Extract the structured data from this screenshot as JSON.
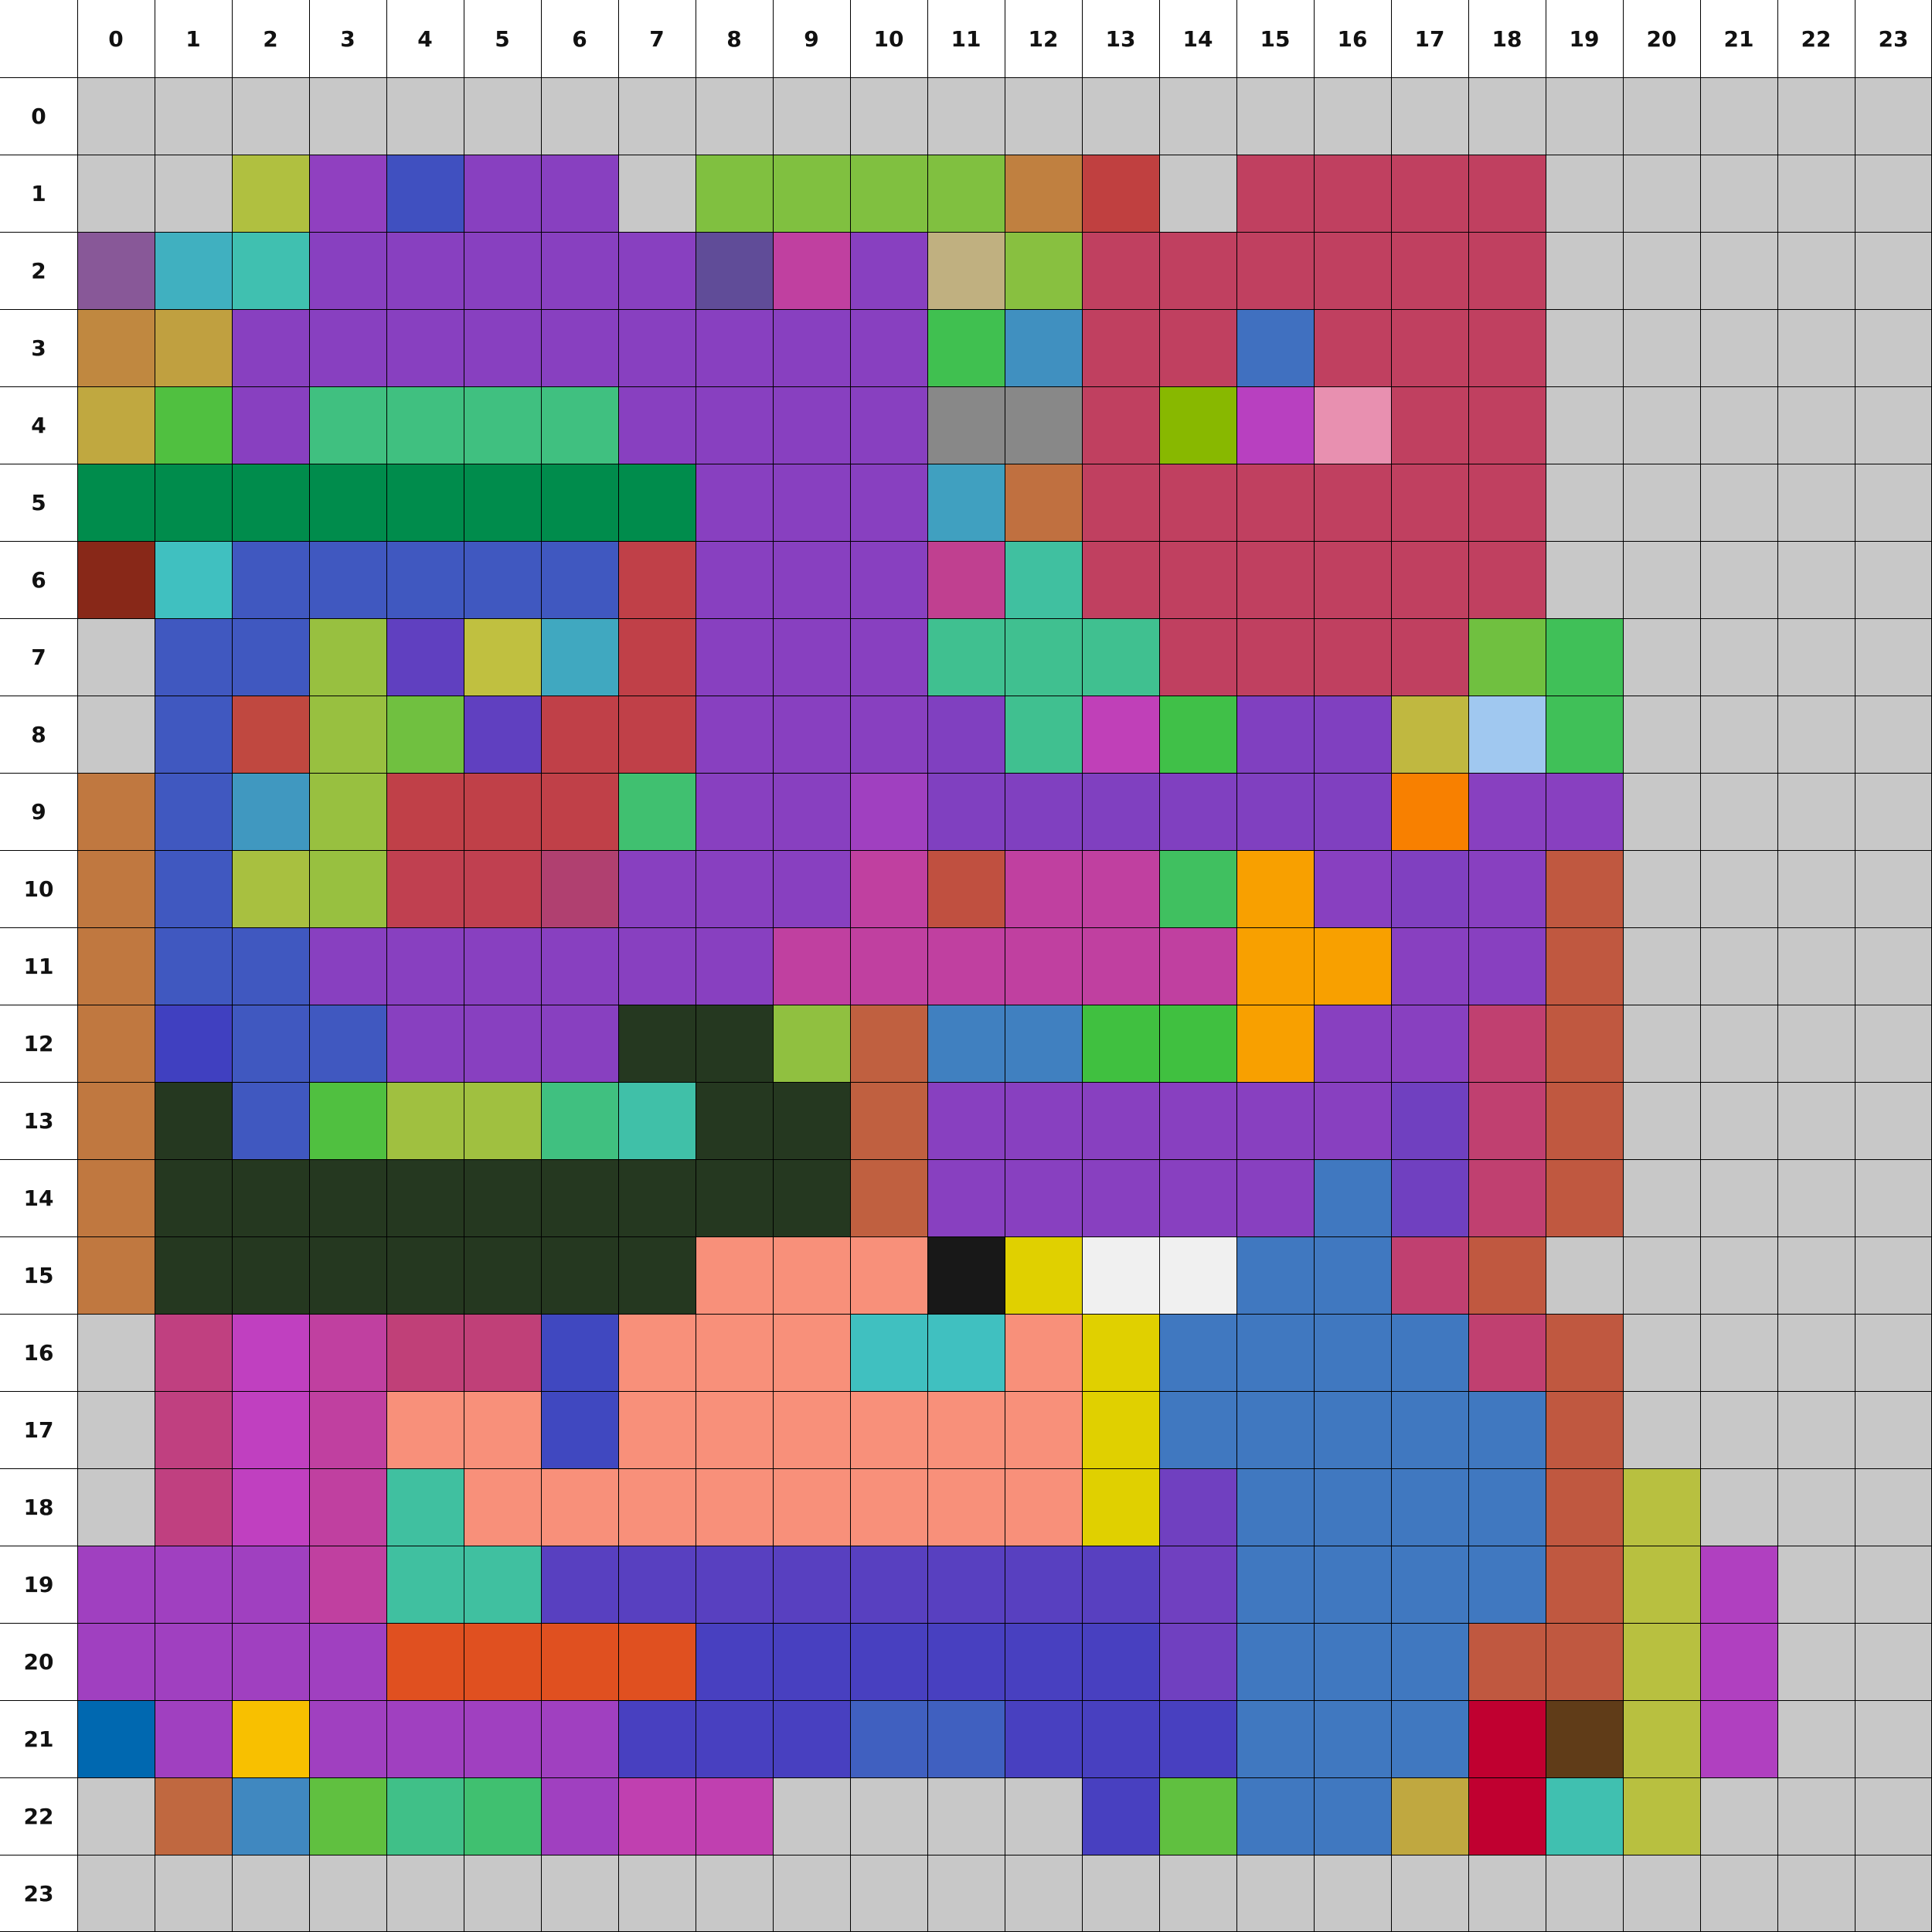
{
  "grid": {
    "rows": 24,
    "cols": 24,
    "col_labels": [
      "0",
      "1",
      "2",
      "3",
      "4",
      "5",
      "6",
      "7",
      "8",
      "9",
      "10",
      "11",
      "12",
      "13",
      "14",
      "15",
      "16",
      "17",
      "18",
      "19",
      "20",
      "21",
      "22",
      "23"
    ],
    "row_labels": [
      "0",
      "1",
      "2",
      "3",
      "4",
      "5",
      "6",
      "7",
      "8",
      "9",
      "10",
      "11",
      "12",
      "13",
      "14",
      "15",
      "16",
      "17",
      "18",
      "19",
      "20",
      "21",
      "22",
      "23"
    ],
    "empty_color": "#c8c8c8",
    "cells": [
      [
        "#c8c8c8",
        "#c8c8c8",
        "#c8c8c8",
        "#c8c8c8",
        "#c8c8c8",
        "#c8c8c8",
        "#c8c8c8",
        "#c8c8c8",
        "#c8c8c8",
        "#c8c8c8",
        "#c8c8c8",
        "#c8c8c8",
        "#c8c8c8",
        "#c8c8c8",
        "#c8c8c8",
        "#c8c8c8",
        "#c8c8c8",
        "#c8c8c8",
        "#c8c8c8",
        "#c8c8c8",
        "#c8c8c8",
        "#c8c8c8",
        "#c8c8c8",
        "#c8c8c8"
      ],
      [
        "#c8c8c8",
        "#c8c8c8",
        "#b0c040",
        "#9040c0",
        "#4050c0",
        "#8840c0",
        "#8840c0",
        "#c8c8c8",
        "#80c040",
        "#80c040",
        "#80c040",
        "#80c040",
        "#c08040",
        "#c04040",
        "#c8c8c8",
        "#c04060",
        "#c04060",
        "#c04060",
        "#c04060",
        "#c8c8c8",
        "#c8c8c8",
        "#c8c8c8",
        "#c8c8c8",
        "#c8c8c8"
      ],
      [
        "#885898",
        "#40b0c0",
        "#40c0b0",
        "#8840c0",
        "#8840c0",
        "#8840c0",
        "#8840c0",
        "#8840c0",
        "#604c98",
        "#c040a0",
        "#8840c0",
        "#c0b080",
        "#88c040",
        "#c04060",
        "#c04060",
        "#c04060",
        "#c04060",
        "#c04060",
        "#c04060",
        "#c8c8c8",
        "#c8c8c8",
        "#c8c8c8",
        "#c8c8c8",
        "#c8c8c8"
      ],
      [
        "#c08840",
        "#c0a040",
        "#8840c0",
        "#8840c0",
        "#8840c0",
        "#8840c0",
        "#8840c0",
        "#8840c0",
        "#8840c0",
        "#8840c0",
        "#8840c0",
        "#40c050",
        "#4090c0",
        "#c04060",
        "#c04060",
        "#4070c0",
        "#c04060",
        "#c04060",
        "#c04060",
        "#c8c8c8",
        "#c8c8c8",
        "#c8c8c8",
        "#c8c8c8",
        "#c8c8c8"
      ],
      [
        "#c0a840",
        "#50c040",
        "#8840c0",
        "#40c080",
        "#40c080",
        "#40c080",
        "#40c080",
        "#8840c0",
        "#8840c0",
        "#8840c0",
        "#8840c0",
        "#888888",
        "#888888",
        "#c04060",
        "#88b800",
        "#b840c0",
        "#e890b0",
        "#c04060",
        "#c04060",
        "#c8c8c8",
        "#c8c8c8",
        "#c8c8c8",
        "#c8c8c8",
        "#c8c8c8"
      ],
      [
        "#008c4c",
        "#008c4c",
        "#008c4c",
        "#008c4c",
        "#008c4c",
        "#008c4c",
        "#008c4c",
        "#008c4c",
        "#8840c0",
        "#8840c0",
        "#8840c0",
        "#40a0c0",
        "#c07040",
        "#c04060",
        "#c04060",
        "#c04060",
        "#c04060",
        "#c04060",
        "#c04060",
        "#c8c8c8",
        "#c8c8c8",
        "#c8c8c8",
        "#c8c8c8",
        "#c8c8c8"
      ],
      [
        "#882818",
        "#40c0c0",
        "#4058c0",
        "#4058c0",
        "#4058c0",
        "#4058c0",
        "#4058c0",
        "#c04048",
        "#8840c0",
        "#8840c0",
        "#8840c0",
        "#c04090",
        "#40c0a0",
        "#c04060",
        "#c04060",
        "#c04060",
        "#c04060",
        "#c04060",
        "#c04060",
        "#c8c8c8",
        "#c8c8c8",
        "#c8c8c8",
        "#c8c8c8",
        "#c8c8c8"
      ],
      [
        "#c8c8c8",
        "#4058c0",
        "#4058c0",
        "#98c040",
        "#6040c0",
        "#c0c040",
        "#40a8c0",
        "#c04048",
        "#8840c0",
        "#8840c0",
        "#8840c0",
        "#40c090",
        "#40c090",
        "#40c090",
        "#c04060",
        "#c04060",
        "#c04060",
        "#c04060",
        "#70c040",
        "#40c058",
        "#c8c8c8",
        "#c8c8c8",
        "#c8c8c8",
        "#c8c8c8"
      ],
      [
        "#c8c8c8",
        "#4058c0",
        "#c04840",
        "#98c040",
        "#70c040",
        "#6040c0",
        "#c04048",
        "#c04048",
        "#8840c0",
        "#8840c0",
        "#8840c0",
        "#8040c0",
        "#40c090",
        "#c040b8",
        "#40c048",
        "#8040c0",
        "#8040c0",
        "#c0b840",
        "#a0c8f0",
        "#40c058",
        "#c8c8c8",
        "#c8c8c8",
        "#c8c8c8",
        "#c8c8c8"
      ],
      [
        "#c07840",
        "#4058c0",
        "#4098c0",
        "#98c040",
        "#c04048",
        "#c04048",
        "#c04048",
        "#40c070",
        "#8840c0",
        "#8840c0",
        "#a040c0",
        "#8040c0",
        "#8040c0",
        "#8040c0",
        "#8040c0",
        "#8040c0",
        "#8040c0",
        "#f88000",
        "#8840c0",
        "#8840c0",
        "#c8c8c8",
        "#c8c8c8",
        "#c8c8c8",
        "#c8c8c8"
      ],
      [
        "#c07840",
        "#4058c0",
        "#a8c040",
        "#98c040",
        "#c04050",
        "#c04050",
        "#b04070",
        "#8840c0",
        "#8840c0",
        "#8840c0",
        "#c040a0",
        "#c05040",
        "#c040a0",
        "#c040a0",
        "#40c060",
        "#f8a000",
        "#8840c0",
        "#8040c0",
        "#8840c0",
        "#c05840",
        "#c8c8c8",
        "#c8c8c8",
        "#c8c8c8",
        "#c8c8c8"
      ],
      [
        "#c07840",
        "#4058c0",
        "#4058c0",
        "#8840c0",
        "#8840c0",
        "#8840c0",
        "#8840c0",
        "#8840c0",
        "#8840c0",
        "#c040a0",
        "#c040a0",
        "#c040a0",
        "#c040a0",
        "#c040a0",
        "#c040a0",
        "#f8a000",
        "#f8a000",
        "#8840c0",
        "#8840c0",
        "#c05840",
        "#c8c8c8",
        "#c8c8c8",
        "#c8c8c8",
        "#c8c8c8"
      ],
      [
        "#c07840",
        "#4040c0",
        "#4058c0",
        "#4058c0",
        "#8840c0",
        "#8840c0",
        "#8840c0",
        "#253820",
        "#253820",
        "#90c040",
        "#c06040",
        "#4080c0",
        "#4080c0",
        "#40c040",
        "#40c040",
        "#f8a000",
        "#8840c0",
        "#8840c0",
        "#c04070",
        "#c05840",
        "#c8c8c8",
        "#c8c8c8",
        "#c8c8c8",
        "#c8c8c8"
      ],
      [
        "#c07840",
        "#253820",
        "#4058c0",
        "#50c040",
        "#a0c040",
        "#a0c040",
        "#40c080",
        "#40c0a8",
        "#253820",
        "#253820",
        "#c06040",
        "#8840c0",
        "#8840c0",
        "#8840c0",
        "#8840c0",
        "#8840c0",
        "#8840c0",
        "#7040c0",
        "#c04070",
        "#c05840",
        "#c8c8c8",
        "#c8c8c8",
        "#c8c8c8",
        "#c8c8c8"
      ],
      [
        "#c07840",
        "#253820",
        "#253820",
        "#253820",
        "#253820",
        "#253820",
        "#253820",
        "#253820",
        "#253820",
        "#253820",
        "#c06040",
        "#8840c0",
        "#8840c0",
        "#8840c0",
        "#8840c0",
        "#8840c0",
        "#4078c0",
        "#7040c0",
        "#c04070",
        "#c05840",
        "#c8c8c8",
        "#c8c8c8",
        "#c8c8c8",
        "#c8c8c8"
      ],
      [
        "#c07840",
        "#253820",
        "#253820",
        "#253820",
        "#253820",
        "#253820",
        "#253820",
        "#253820",
        "#f8907a",
        "#f8907a",
        "#f8907a",
        "#181818",
        "#e0d000",
        "#f0f0f0",
        "#f0f0f0",
        "#4078c0",
        "#4078c0",
        "#c04070",
        "#c05840",
        "#c8c8c8",
        "#c8c8c8",
        "#c8c8c8",
        "#c8c8c8",
        "#c8c8c8"
      ],
      [
        "#c8c8c8",
        "#c04080",
        "#c040c0",
        "#c040a0",
        "#c04078",
        "#c04078",
        "#4048c0",
        "#f8907a",
        "#f8907a",
        "#f8907a",
        "#40c0c0",
        "#40c0c0",
        "#f8907a",
        "#e0d000",
        "#4078c0",
        "#4078c0",
        "#4078c0",
        "#4078c0",
        "#c04070",
        "#c05840",
        "#c8c8c8",
        "#c8c8c8",
        "#c8c8c8",
        "#c8c8c8"
      ],
      [
        "#c8c8c8",
        "#c04080",
        "#c040c0",
        "#c040a0",
        "#f8907a",
        "#f8907a",
        "#4048c0",
        "#f8907a",
        "#f8907a",
        "#f8907a",
        "#f8907a",
        "#f8907a",
        "#f8907a",
        "#e0d000",
        "#4078c0",
        "#4078c0",
        "#4078c0",
        "#4078c0",
        "#4078c0",
        "#c05840",
        "#c8c8c8",
        "#c8c8c8",
        "#c8c8c8",
        "#c8c8c8"
      ],
      [
        "#c8c8c8",
        "#c04080",
        "#c040c0",
        "#c040a0",
        "#40c0a0",
        "#f8907a",
        "#f8907a",
        "#f8907a",
        "#f8907a",
        "#f8907a",
        "#f8907a",
        "#f8907a",
        "#f8907a",
        "#e0d000",
        "#7040c0",
        "#4078c0",
        "#4078c0",
        "#4078c0",
        "#4078c0",
        "#c05840",
        "#b8c040",
        "#c8c8c8",
        "#c8c8c8",
        "#c8c8c8"
      ],
      [
        "#a040c0",
        "#a040c0",
        "#a040c0",
        "#c040a0",
        "#40c0a0",
        "#40c0a0",
        "#5840c0",
        "#5840c0",
        "#5840c0",
        "#5840c0",
        "#5840c0",
        "#5840c0",
        "#5840c0",
        "#5840c0",
        "#7040c0",
        "#4078c0",
        "#4078c0",
        "#4078c0",
        "#4078c0",
        "#c05840",
        "#b8c040",
        "#b040c0",
        "#c8c8c8",
        "#c8c8c8"
      ],
      [
        "#a040c0",
        "#a040c0",
        "#a040c0",
        "#a040c0",
        "#e05020",
        "#e05020",
        "#e05020",
        "#e05020",
        "#4840c0",
        "#4840c0",
        "#4840c0",
        "#4840c0",
        "#4840c0",
        "#4840c0",
        "#7040c0",
        "#4078c0",
        "#4078c0",
        "#4078c0",
        "#c05840",
        "#c05840",
        "#b8c040",
        "#b040c0",
        "#c8c8c8",
        "#c8c8c8"
      ],
      [
        "#0068b0",
        "#a040c0",
        "#f8c000",
        "#a040c0",
        "#a040c0",
        "#a040c0",
        "#a040c0",
        "#4840c0",
        "#4840c0",
        "#4840c0",
        "#4060c0",
        "#4060c0",
        "#4840c0",
        "#4840c0",
        "#4840c0",
        "#4078c0",
        "#4078c0",
        "#4078c0",
        "#c00030",
        "#603c18",
        "#b8c040",
        "#b040c0",
        "#c8c8c8",
        "#c8c8c8"
      ],
      [
        "#c8c8c8",
        "#c06840",
        "#4088c0",
        "#60c040",
        "#40c088",
        "#40c070",
        "#a040c0",
        "#c040b0",
        "#c040b0",
        "#c8c8c8",
        "#c8c8c8",
        "#c8c8c8",
        "#c8c8c8",
        "#4840c0",
        "#60c040",
        "#4078c0",
        "#4078c0",
        "#c0a840",
        "#c00030",
        "#40c0b0",
        "#b8c040",
        "#c8c8c8",
        "#c8c8c8",
        "#c8c8c8"
      ],
      [
        "#c8c8c8",
        "#c8c8c8",
        "#c8c8c8",
        "#c8c8c8",
        "#c8c8c8",
        "#c8c8c8",
        "#c8c8c8",
        "#c8c8c8",
        "#c8c8c8",
        "#c8c8c8",
        "#c8c8c8",
        "#c8c8c8",
        "#c8c8c8",
        "#c8c8c8",
        "#c8c8c8",
        "#c8c8c8",
        "#c8c8c8",
        "#c8c8c8",
        "#c8c8c8",
        "#c8c8c8",
        "#c8c8c8",
        "#c8c8c8",
        "#c8c8c8",
        "#c8c8c8"
      ]
    ]
  }
}
